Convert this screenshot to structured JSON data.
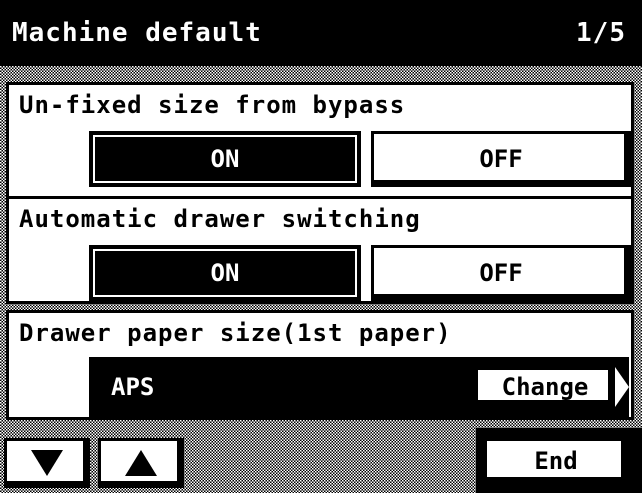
{
  "header": {
    "title": "Machine default",
    "page_indicator": "1/5"
  },
  "sections": [
    {
      "title": "Un-fixed size from bypass",
      "on_label": "ON",
      "off_label": "OFF",
      "selected": "ON"
    },
    {
      "title": "Automatic drawer switching",
      "on_label": "ON",
      "off_label": "OFF",
      "selected": "ON"
    },
    {
      "title": "Drawer paper size(1st paper)",
      "value": "APS",
      "change_label": "Change"
    }
  ],
  "footer": {
    "end_label": "End",
    "icons": {
      "down": "triangle-down",
      "up": "triangle-up"
    }
  }
}
